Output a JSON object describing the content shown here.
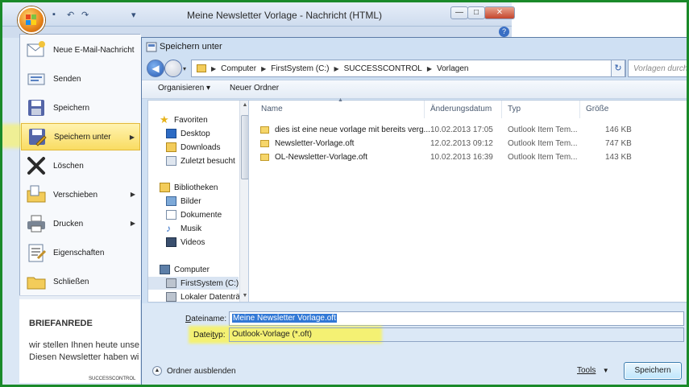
{
  "outlook": {
    "title": "Meine Newsletter Vorlage - Nachricht (HTML)",
    "window_min": "—",
    "window_max": "□",
    "window_close": "✕",
    "help": "?",
    "qat_save": "▪",
    "qat_undo": "↶",
    "qat_redo": "↷",
    "qat_more": "▾"
  },
  "office_menu": {
    "items": [
      {
        "label": "Neue E-Mail-Nachricht",
        "icon": "new-mail-icon"
      },
      {
        "label": "Senden",
        "icon": "send-icon"
      },
      {
        "label": "Speichern",
        "icon": "floppy-icon"
      },
      {
        "label": "Speichern unter",
        "icon": "save-as-icon"
      },
      {
        "label": "Löschen",
        "icon": "delete-x-icon"
      },
      {
        "label": "Verschieben",
        "icon": "move-folder-icon"
      },
      {
        "label": "Drucken",
        "icon": "printer-icon"
      },
      {
        "label": "Eigenschaften",
        "icon": "properties-icon"
      },
      {
        "label": "Schließen",
        "icon": "close-folder-icon"
      }
    ],
    "submenu_arrow": "▶"
  },
  "doc": {
    "heading": "BRIEFANREDE",
    "line1": "wir stellen Ihnen heute unse",
    "line2": "Diesen Newsletter haben wi",
    "logo_text": "SUCCESSCONTROL"
  },
  "dialog": {
    "title": "Speichern unter",
    "back": "◀",
    "breadcrumb": [
      "Computer",
      "FirstSystem (C:)",
      "SUCCESSCONTROL",
      "Vorlagen"
    ],
    "crumb_sep": "▶",
    "search_placeholder": "Vorlagen durchsuchen",
    "refresh": "↻",
    "toolbar": {
      "organize": "Organisieren",
      "organize_arrow": "▾",
      "new_folder": "Neuer Ordner"
    },
    "nav": {
      "favorites": "Favoriten",
      "desktop": "Desktop",
      "downloads": "Downloads",
      "recent": "Zuletzt besucht",
      "libraries": "Bibliotheken",
      "pictures": "Bilder",
      "documents": "Dokumente",
      "music": "Musik",
      "videos": "Videos",
      "computer": "Computer",
      "drive_c": "FirstSystem (C:)",
      "local_drive": "Lokaler Datenträg"
    },
    "columns": {
      "name": "Name",
      "modified": "Änderungsdatum",
      "type": "Typ",
      "size": "Größe"
    },
    "files": [
      {
        "name": "dies ist eine neue vorlage mit bereits verg...",
        "modified": "10.02.2013 17:05",
        "type": "Outlook Item Tem...",
        "size": "146 KB"
      },
      {
        "name": "Newsletter-Vorlage.oft",
        "modified": "12.02.2013 09:12",
        "type": "Outlook Item Tem...",
        "size": "747 KB"
      },
      {
        "name": "OL-Newsletter-Vorlage.oft",
        "modified": "10.02.2013 16:39",
        "type": "Outlook Item Tem...",
        "size": "143 KB"
      }
    ],
    "filename_label_pre": "D",
    "filename_label_post": "ateiname:",
    "filename_value": "Meine Newsletter Vorlage.oft",
    "filetype_label_pre": "Datei",
    "filetype_label_u": "t",
    "filetype_label_post": "yp:",
    "filetype_value": "Outlook-Vorlage (*.oft)",
    "hide_folders": "Ordner ausblenden",
    "hide_arrow": "▲",
    "tools": "Tools",
    "tools_arrow": "▼",
    "save": "Speichern"
  },
  "colors": {
    "highlight": "#fff546",
    "frame": "#1a8a2a",
    "accent": "#3178d6"
  }
}
